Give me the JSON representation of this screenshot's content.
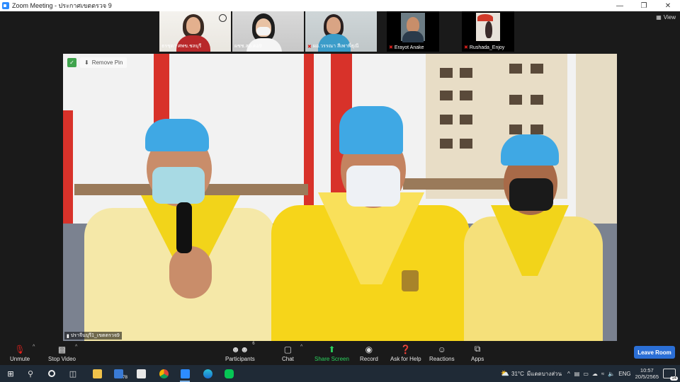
{
  "window": {
    "title": "Zoom Meeting - ประกาศเขตตรวจ 9",
    "controls": [
      "minimize",
      "restore",
      "close"
    ]
  },
  "view_button": {
    "label": "View"
  },
  "thumbnails": [
    {
      "name": "ธรชุดา ศพข.ชลบุรี",
      "muted": false
    },
    {
      "name": "ผชช.สอ.ตอ9",
      "muted": false
    },
    {
      "name": "ผอ.วรรณา สีเพาพี่ธุณี",
      "muted": true
    },
    {
      "name": "Erayot Anake",
      "muted": true
    },
    {
      "name": "Rushada_Enjoy",
      "muted": true
    }
  ],
  "main_video": {
    "remove_pin_label": "Remove Pin",
    "speaker_name": "ปราจีนบุรี1_เขตตรวจ9"
  },
  "toolbar": {
    "unmute": "Unmute",
    "stop_video": "Stop Video",
    "participants": "Participants",
    "participants_count": "6",
    "chat": "Chat",
    "share_screen": "Share Screen",
    "record": "Record",
    "ask_for_help": "Ask for Help",
    "reactions": "Reactions",
    "apps": "Apps",
    "leave_room": "Leave Room"
  },
  "taskbar": {
    "badge_count": "78",
    "weather_temp": "31°C",
    "weather_desc": "มีแดดบางส่วน",
    "language": "ENG",
    "time": "10:57",
    "date": "20/5/2565",
    "notification_count": "14"
  },
  "colors": {
    "share_green": "#2bd15d",
    "leave_blue": "#2b6fd6",
    "mute_red": "#e0201c",
    "taskbar_bg": "#1f2a36",
    "shirt_yellow": "#f2d41a",
    "cap_blue": "#3fa8e4"
  }
}
